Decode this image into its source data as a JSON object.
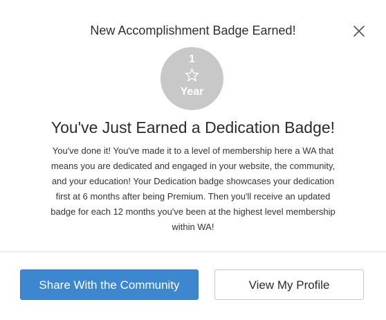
{
  "modal": {
    "header_title": "New Accomplishment Badge Earned!",
    "close_icon": "close-icon"
  },
  "badge": {
    "number": "1",
    "icon": "star-outline-icon",
    "label": "Year",
    "color": "#c8c8c8"
  },
  "content": {
    "headline": "You've Just Earned a Dedication Badge!",
    "lines": [
      "You've done it! You've made it to a level of membership here a WA that",
      "means you are dedicated and engaged in your website, the community,",
      "and your education! Your Dedication badge showcases your dedication",
      "first at 6 months after being Premium. Then you'll receive an updated",
      "badge for each 12 months you've been at the highest level membership",
      "within WA!"
    ]
  },
  "actions": {
    "share_label": "Share With the Community",
    "profile_label": "View My Profile",
    "primary_color": "#3c87d0"
  }
}
